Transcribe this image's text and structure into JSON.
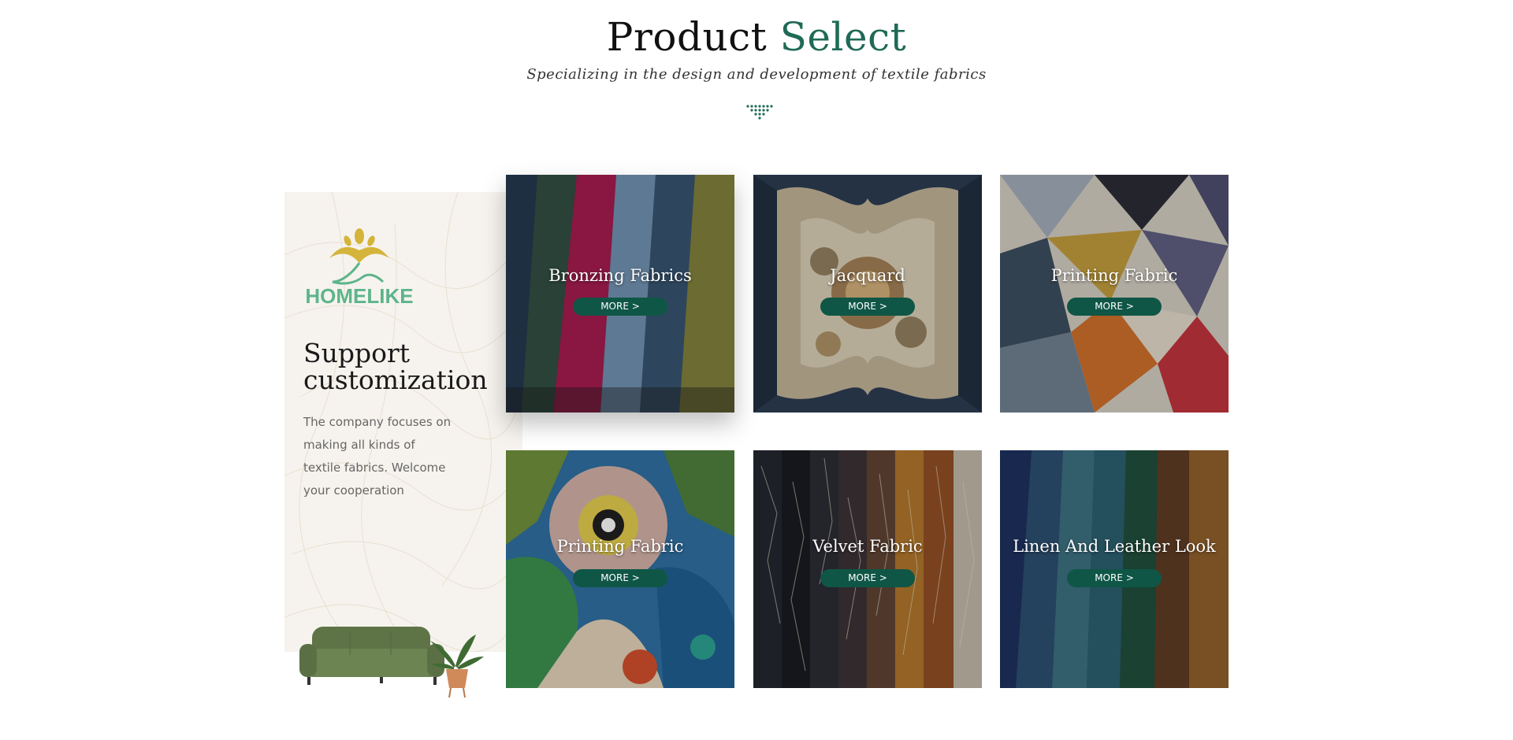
{
  "header": {
    "title_main": "Product",
    "title_accent": "Select",
    "subtitle": "Specializing in the design and development of textile fabrics"
  },
  "sidebar": {
    "logo_text": "HOMELIKE",
    "heading": "Support customization",
    "description": "The company focuses on making all kinds of textile fabrics. Welcome your cooperation"
  },
  "products": [
    {
      "name": "Bronzing Fabrics",
      "button": "MORE >"
    },
    {
      "name": "Jacquard",
      "button": "MORE >"
    },
    {
      "name": "Printing Fabric",
      "button": "MORE >"
    },
    {
      "name": "Printing Fabric",
      "button": "MORE >"
    },
    {
      "name": "Velvet Fabric",
      "button": "MORE >"
    },
    {
      "name": "Linen And Leather Look",
      "button": "MORE >"
    }
  ],
  "colors": {
    "accent": "#1f6a56",
    "button": "#0f5646",
    "logo_green": "#5db58a",
    "logo_gold": "#d4b43a"
  }
}
